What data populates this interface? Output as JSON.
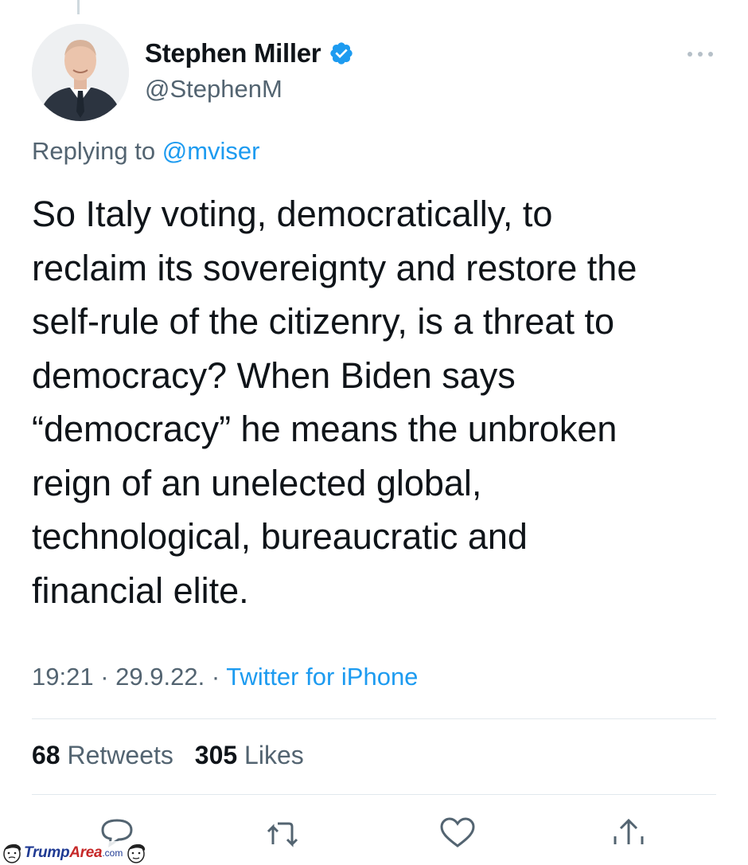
{
  "author": {
    "name": "Stephen Miller",
    "handle": "@StephenM",
    "verified": true
  },
  "reply": {
    "prefix": "Replying to",
    "mention": "@mviser"
  },
  "tweet": {
    "text": "So Italy voting, democratically, to\nreclaim its sovereignty and restore the\nself-rule of the citizenry, is a threat to\ndemocracy? When Biden says\n“democracy” he means the unbroken\nreign of an unelected global,\ntechnological, bureaucratic and\nfinancial elite."
  },
  "meta": {
    "time": "19:21",
    "date": "29.9.22.",
    "source": "Twitter for iPhone"
  },
  "stats": {
    "retweets_count": "68",
    "retweets_label": "Retweets",
    "likes_count": "305",
    "likes_label": "Likes"
  },
  "actions": [
    "reply-icon",
    "retweet-icon",
    "like-icon",
    "share-icon"
  ],
  "watermark": {
    "brand_a": "Trump",
    "brand_b": "Area",
    "suffix": ".com"
  },
  "colors": {
    "accent": "#1d9bf0",
    "secondary_text": "#536471",
    "primary_text": "#0f1419"
  }
}
